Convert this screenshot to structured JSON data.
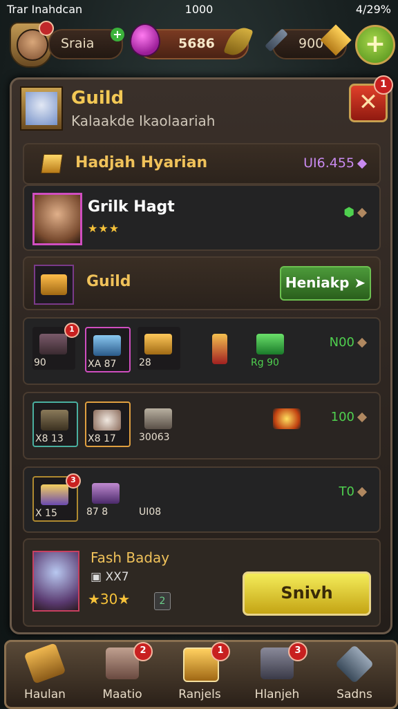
{
  "status_bar": {
    "left": "Trar Inahdcan",
    "center": "1000",
    "right": "4/29%"
  },
  "top_bar": {
    "name_pill": "Sraia",
    "gems_value": "5686",
    "currency_value": "900",
    "plus_icon": "plus"
  },
  "panel": {
    "title": "Guild",
    "subtitle": "Kalaakde Ikaolaariah",
    "close_label": "✕",
    "close_badge": "1",
    "row1": {
      "label": "Hadjah Hyarian",
      "value": "UI6.455"
    },
    "row2": {
      "name": "Grilk Hagt",
      "stars": "★★★"
    },
    "row3": {
      "label": "Guild",
      "button": "Heniakp"
    },
    "row4": {
      "items": [
        "90",
        "XA 87",
        "28",
        "",
        "Rg 90"
      ],
      "badge": "1",
      "right": "N00"
    },
    "row5": {
      "items": [
        "X8 13",
        "X8 17",
        "30063"
      ],
      "right": "100"
    },
    "row6": {
      "items": [
        "X 15",
        "87 8",
        "UI08"
      ],
      "badge": "3",
      "right": "T0"
    },
    "row7": {
      "title": "Fash Baday",
      "sub": "XX7",
      "stars": "★30★",
      "small": "2",
      "button": "Snivh"
    }
  },
  "bottom_nav": [
    {
      "label": "Haulan",
      "badge": ""
    },
    {
      "label": "Maatio",
      "badge": "2"
    },
    {
      "label": "Ranjels",
      "badge": "1"
    },
    {
      "label": "Hlanjeh",
      "badge": "3"
    },
    {
      "label": "Sadns",
      "badge": ""
    }
  ],
  "colors": {
    "accent_gold": "#f0c25a",
    "green": "#4fd04f",
    "red": "#c82020"
  }
}
